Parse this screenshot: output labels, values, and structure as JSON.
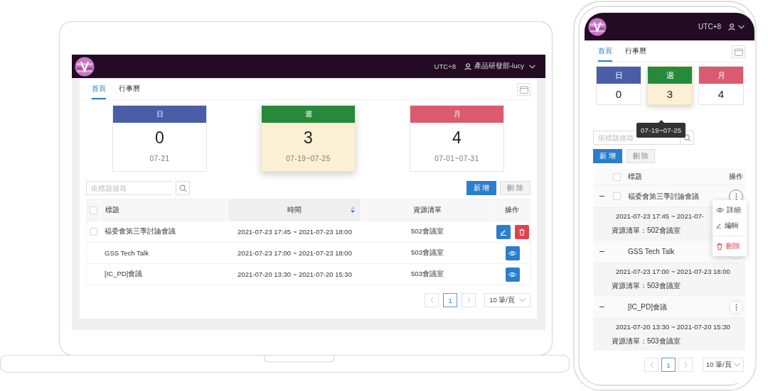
{
  "laptop": {
    "header": {
      "timezone": "UTC+8",
      "user": "產品研發部-lucy"
    },
    "tabs": [
      {
        "label": "首頁",
        "selected": true
      },
      {
        "label": "行事曆",
        "selected": false
      }
    ],
    "summary_cards": [
      {
        "label": "日",
        "count": "0",
        "range": "07-21",
        "color": "#4a5ea8",
        "selected": false
      },
      {
        "label": "週",
        "count": "3",
        "range": "07-19~07-25",
        "color": "#268a3a",
        "selected": true
      },
      {
        "label": "月",
        "count": "4",
        "range": "07-01~07-31",
        "color": "#db5a6e",
        "selected": false
      }
    ],
    "search": {
      "placeholder": "依標題搜尋"
    },
    "buttons": [
      {
        "label": "新 增",
        "disabled": false
      },
      {
        "label": "刪 除",
        "disabled": true
      }
    ],
    "table": {
      "select_all_checked": false,
      "columns": [
        {
          "label": "標題",
          "sorted": false
        },
        {
          "label": "時間",
          "sorted": true
        },
        {
          "label": "資源清單",
          "sorted": false
        },
        {
          "label": "操作",
          "sorted": false
        }
      ],
      "rows": [
        {
          "checked": false,
          "title": "福委會第三季討論會議",
          "time": "2021-07-23 17:45 ~ 2021-07-23 18:00",
          "resource": "502會議室",
          "actions": [
            {
              "kind": "edit"
            },
            {
              "kind": "delete"
            }
          ]
        },
        {
          "title": "GSS Tech Talk",
          "time": "2021-07-23 17:00 ~ 2021-07-23 18:00",
          "resource": "503會議室",
          "actions": [
            {
              "kind": "view"
            }
          ]
        },
        {
          "title": "[IC_PD]會議",
          "time": "2021-07-20 13:30 ~ 2021-07-20 15:30",
          "resource": "503會議室",
          "actions": [
            {
              "kind": "view"
            }
          ]
        }
      ]
    },
    "pagination": {
      "page": "1",
      "page_size": "10 筆/頁"
    }
  },
  "phone": {
    "header": {
      "timezone": "UTC+8"
    },
    "tabs": [
      {
        "label": "首頁",
        "selected": true
      },
      {
        "label": "行事曆",
        "selected": false
      }
    ],
    "summary_cards": [
      {
        "label": "日",
        "count": "0",
        "color": "#4a5ea8",
        "selected": false
      },
      {
        "label": "週",
        "count": "3",
        "color": "#268a3a",
        "selected": true
      },
      {
        "label": "月",
        "count": "4",
        "color": "#db5a6e",
        "selected": false
      }
    ],
    "tooltip": "07-19~07-25",
    "search": {
      "placeholder": "依標題搜尋"
    },
    "buttons": [
      {
        "label": "新 增",
        "disabled": false
      },
      {
        "label": "刪 除",
        "disabled": true
      }
    ],
    "table": {
      "select_all_checked": false,
      "columns": [
        {
          "label": "標題"
        },
        {
          "label": "操作"
        }
      ],
      "rows": [
        {
          "expanded": true,
          "checked": false,
          "title": "福委會第三季討論會議",
          "time": "2021-07-23 17:45 ~ 2021-07-",
          "resource": "資源清單：502會議室"
        },
        {
          "expanded": true,
          "title": "GSS Tech Talk",
          "time": "2021-07-23 17:00 ~ 2021-07-23 18:00",
          "resource": "資源清單：503會議室"
        },
        {
          "expanded": true,
          "title": "[IC_PD]會議",
          "time": "2021-07-20 13:30 ~ 2021-07-20 15:30",
          "resource": "資源清單：503會議室"
        }
      ]
    },
    "row_menu": [
      {
        "kind": "view",
        "label": "詳細"
      },
      {
        "kind": "edit",
        "label": "編輯"
      },
      {
        "kind": "delete",
        "label": "刪除"
      }
    ],
    "pagination": {
      "page": "1",
      "page_size": "10 筆/頁"
    }
  }
}
